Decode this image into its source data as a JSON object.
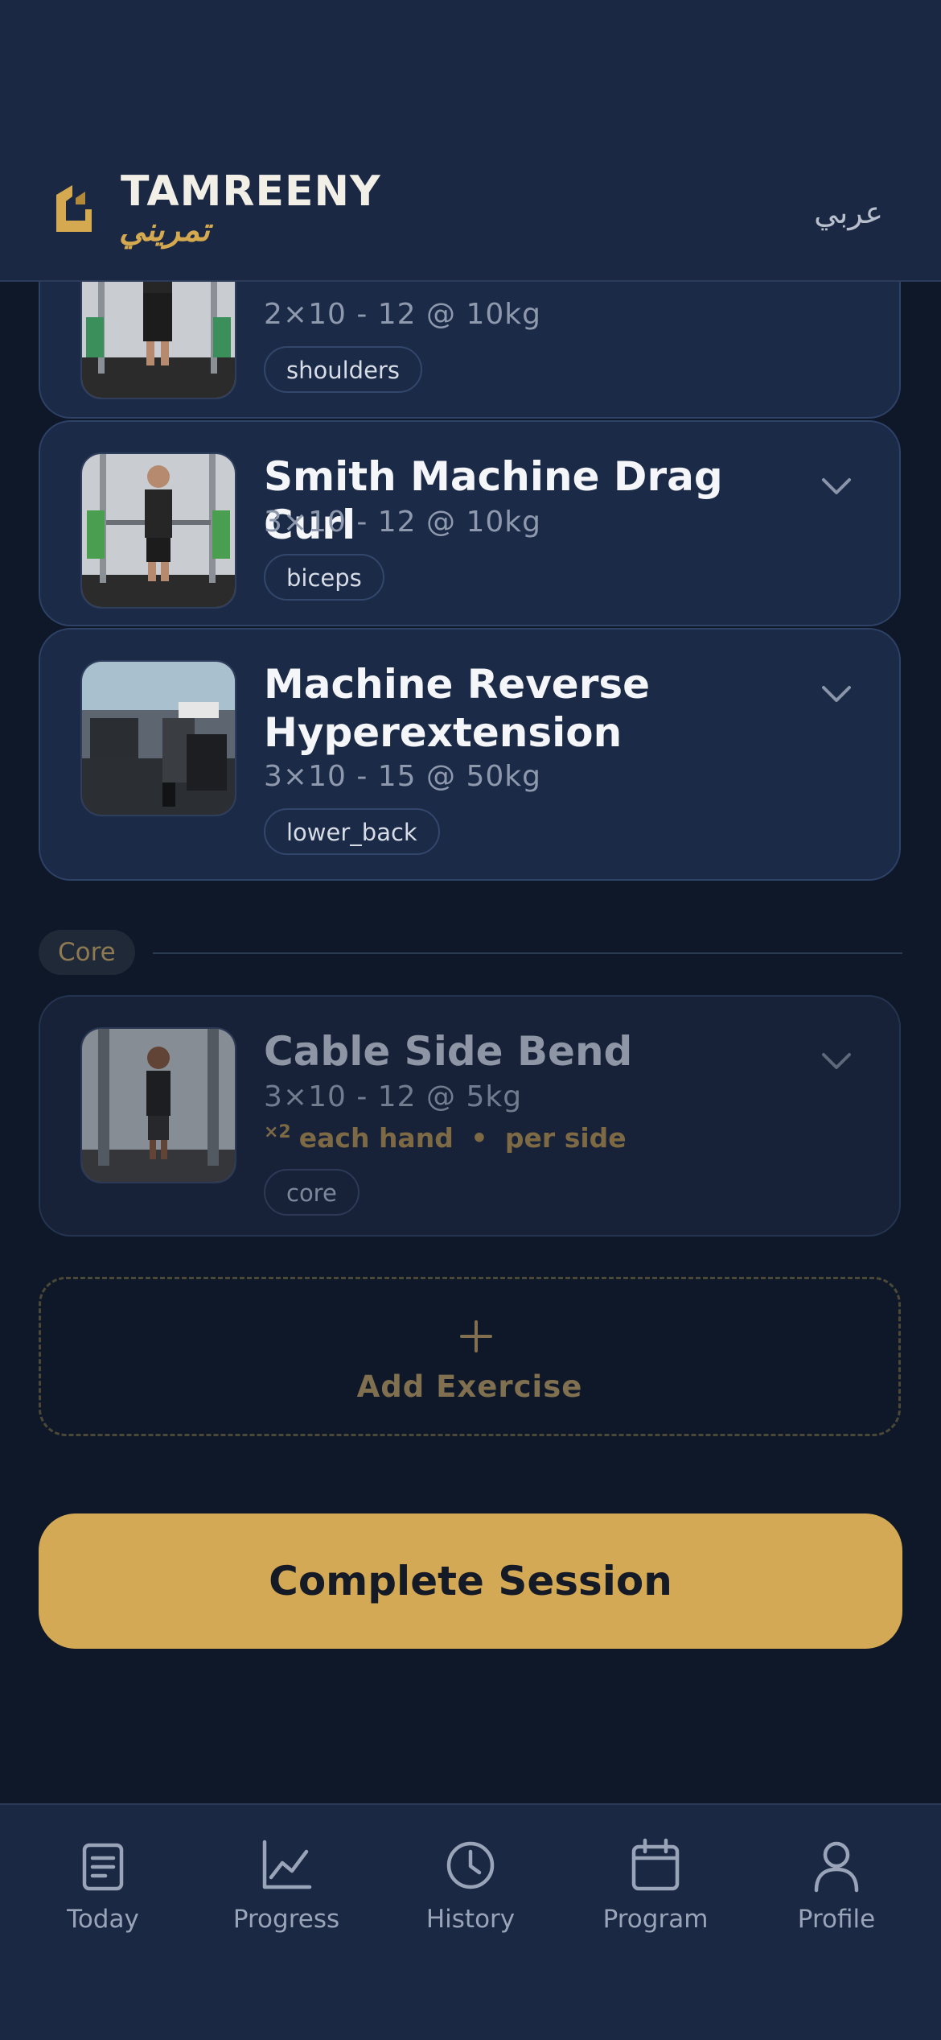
{
  "header": {
    "brand": "TAMREENY",
    "brand_arabic": "تمريني",
    "language_toggle": "عربي",
    "brand_color": "#d4a94f"
  },
  "exercises": [
    {
      "name": "",
      "spec": "2×10 - 12 @ 10kg",
      "tag": "shoulders",
      "thumb": "smith-machine-photo"
    },
    {
      "name": "Smith Machine Drag Curl",
      "spec": "3×10 - 12 @ 10kg",
      "tag": "biceps",
      "thumb": "smith-machine-photo"
    },
    {
      "name": "Machine Reverse Hyperextension",
      "spec": "3×10 - 15 @ 50kg",
      "tag": "lower_back",
      "thumb": "gym-floor-photo"
    }
  ],
  "sections": [
    {
      "label": "Core",
      "exercises": [
        {
          "name": "Cable Side Bend",
          "spec": "3×10 - 12 @ 5kg",
          "multiplier": "×2",
          "note_hand": "each hand",
          "note_separator": "•",
          "note_side": "per side",
          "tag": "core",
          "thumb": "cable-station-photo"
        }
      ]
    }
  ],
  "actions": {
    "add_exercise": "Add Exercise",
    "complete_session": "Complete Session"
  },
  "nav": [
    {
      "label": "Today",
      "icon": "clipboard-icon"
    },
    {
      "label": "Progress",
      "icon": "chart-icon"
    },
    {
      "label": "History",
      "icon": "clock-icon"
    },
    {
      "label": "Program",
      "icon": "calendar-icon"
    },
    {
      "label": "Profile",
      "icon": "user-icon"
    }
  ],
  "colors": {
    "background": "#0e1828",
    "surface": "#1b2843",
    "accent": "#d4a956"
  }
}
